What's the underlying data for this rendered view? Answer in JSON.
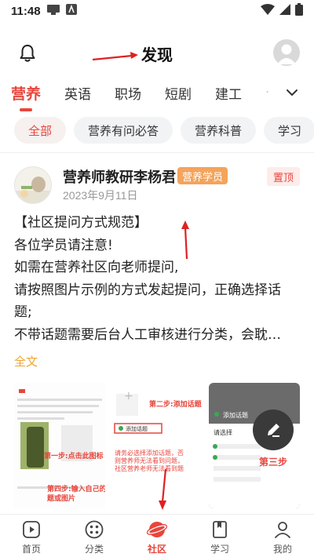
{
  "status": {
    "time": "11:48",
    "battery_icon": "battery-icon",
    "wifi_icon": "wifi-icon"
  },
  "header": {
    "title": "发现"
  },
  "tabs": [
    {
      "label": "营养",
      "active": true
    },
    {
      "label": "英语"
    },
    {
      "label": "职场"
    },
    {
      "label": "短剧"
    },
    {
      "label": "建工"
    }
  ],
  "chips": [
    {
      "label": "全部",
      "active": true
    },
    {
      "label": "营养有问必答"
    },
    {
      "label": "营养科普"
    },
    {
      "label": "学习"
    }
  ],
  "post": {
    "author": "营养师教研李杨君",
    "badge": "营养学员",
    "pin": "置顶",
    "date": "2023年9月11日",
    "lines": [
      "【社区提问方式规范】",
      "各位学员请注意!",
      "如需在营养社区向老师提问,",
      "请按照图片示例的方式发起提问，正确选择话",
      "题;",
      "不带话题需要后台人工审核进行分类，会耽…"
    ],
    "more": "全文"
  },
  "images": {
    "img1_text": [
      "第一步:点击此图标",
      "第四步:输入自己的问",
      "题或图片"
    ],
    "img2_text": [
      "第二步:添加话题",
      "添加话题",
      "请务必选择添加话题，否",
      "则营养师无法看到问题，",
      "社区营养老师无法看到题"
    ],
    "img3_text": [
      "添加话题",
      "请选择",
      "第三步"
    ]
  },
  "nav": [
    {
      "label": "首页",
      "icon": "home-icon"
    },
    {
      "label": "分类",
      "icon": "category-icon"
    },
    {
      "label": "社区",
      "icon": "community-icon",
      "active": true
    },
    {
      "label": "学习",
      "icon": "study-icon"
    },
    {
      "label": "我的",
      "icon": "profile-icon"
    }
  ],
  "colors": {
    "accent": "#e8453c",
    "badge": "#f4a45c",
    "link": "#f0a52c"
  }
}
